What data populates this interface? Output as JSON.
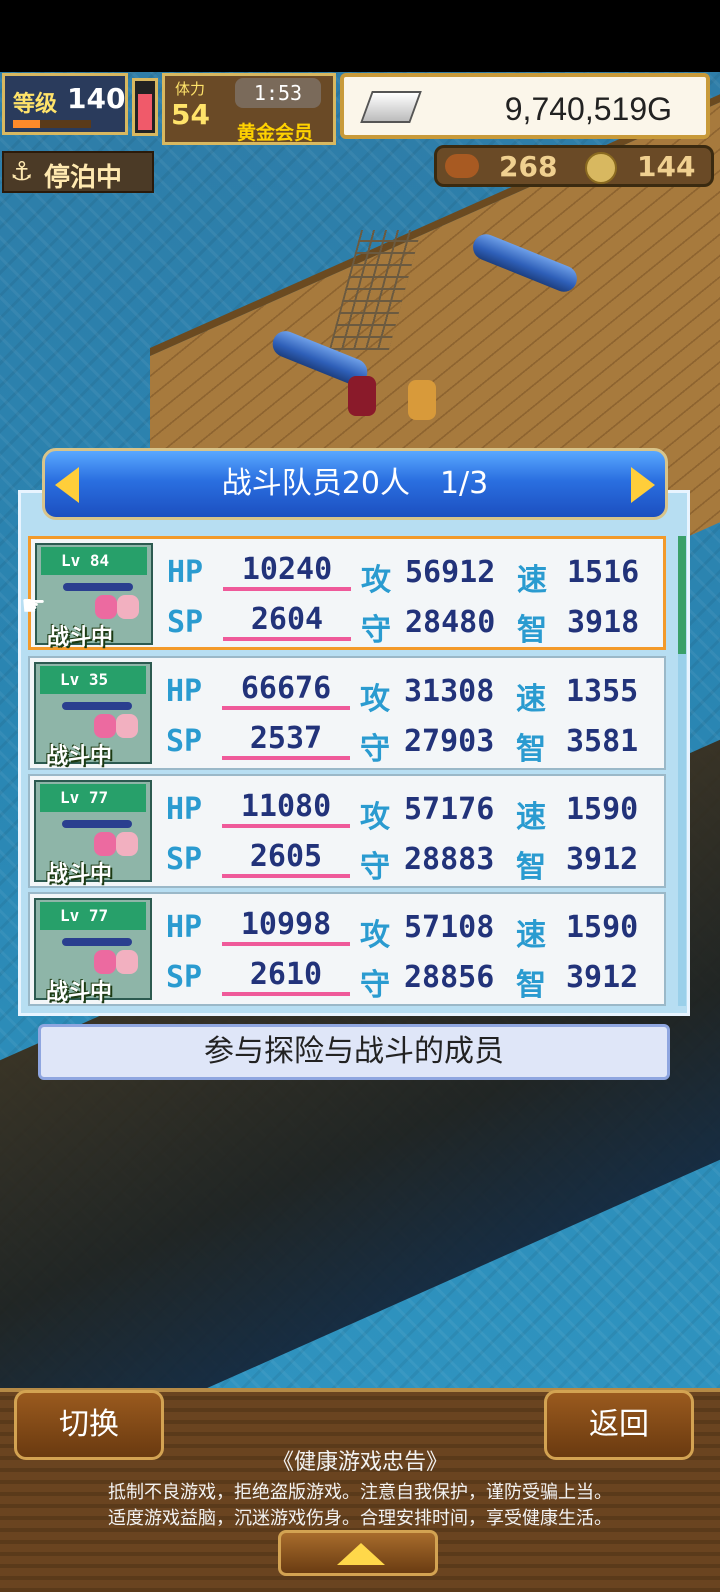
{
  "hud": {
    "level_label": "等级",
    "level": "140",
    "xp_fraction": 0.35,
    "hp_gauge_fraction": 0.7,
    "member_number": "54",
    "member_top": "体力",
    "timer": "1:53",
    "member_rank": "黄金会员",
    "money": "9,740,519G",
    "status": "停泊中",
    "food": "268",
    "coins": "144"
  },
  "panel": {
    "title": "战斗队员20人　1/3",
    "description": "参与探险与战斗的成员",
    "stat_labels": {
      "hp": "HP",
      "sp": "SP",
      "atk": "攻",
      "def": "守",
      "spd": "速",
      "int": "智"
    },
    "scroll_fraction": 0.25
  },
  "members": [
    {
      "lv": "Lv 84",
      "status": "战斗中",
      "hp": "10240",
      "sp": "2604",
      "atk": "56912",
      "def": "28480",
      "spd": "1516",
      "int": "3918",
      "selected": true,
      "star": false
    },
    {
      "lv": "Lv 35",
      "status": "战斗中",
      "hp": "66676",
      "sp": "2537",
      "atk": "31308",
      "def": "27903",
      "spd": "1355",
      "int": "3581",
      "selected": false,
      "star": true
    },
    {
      "lv": "Lv 77",
      "status": "战斗中",
      "hp": "11080",
      "sp": "2605",
      "atk": "57176",
      "def": "28883",
      "spd": "1590",
      "int": "3912",
      "selected": false,
      "star": false
    },
    {
      "lv": "Lv 77",
      "status": "战斗中",
      "hp": "10998",
      "sp": "2610",
      "atk": "57108",
      "def": "28856",
      "spd": "1590",
      "int": "3912",
      "selected": false,
      "star": false
    }
  ],
  "bottom": {
    "switch_label": "切换",
    "back_label": "返回",
    "notice_title": "《健康游戏忠告》",
    "notice_line1": "抵制不良游戏，拒绝盗版游戏。注意自我保护，谨防受骗上当。",
    "notice_line2": "适度游戏益脑，沉迷游戏伤身。合理安排时间，享受健康生活。"
  }
}
